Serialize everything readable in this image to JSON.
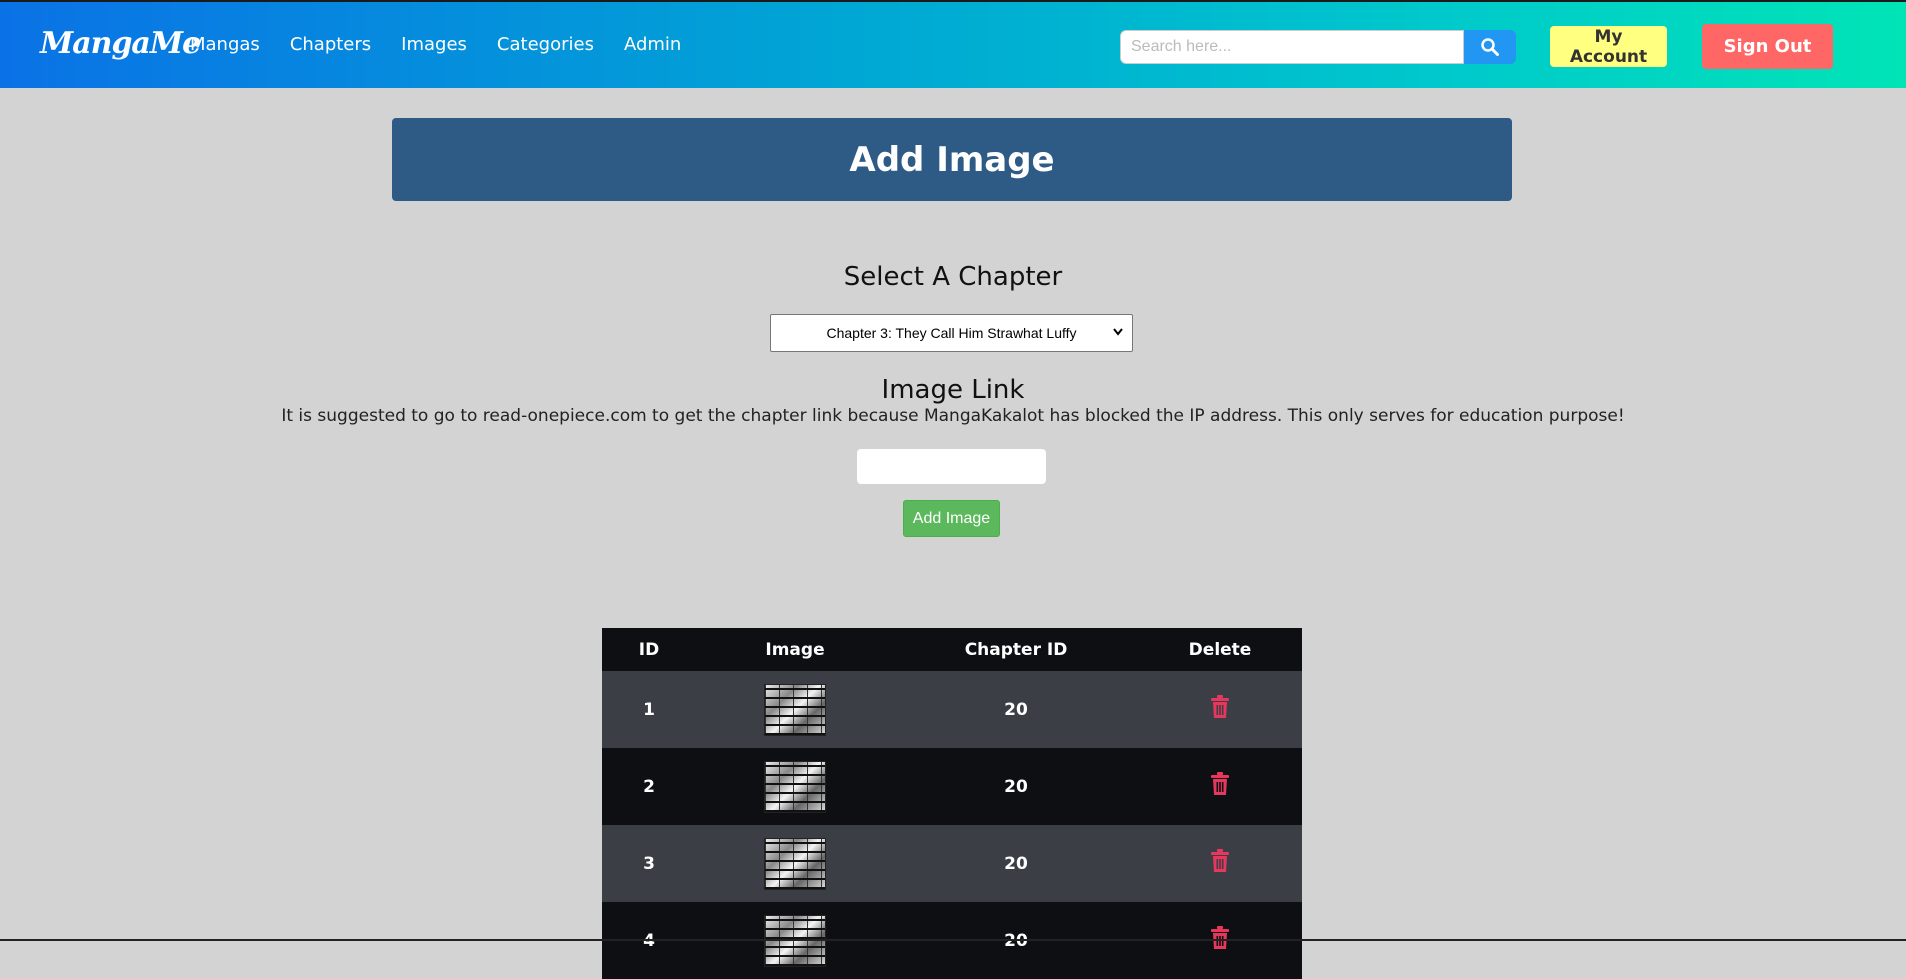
{
  "navbar": {
    "logo": "MangaMe",
    "links": [
      "Mangas",
      "Chapters",
      "Images",
      "Categories",
      "Admin"
    ],
    "search_placeholder": "Search here...",
    "my_account_label": "My Account",
    "sign_out_label": "Sign Out",
    "colors": {
      "gradient_start": "#0a72e6",
      "gradient_end": "#00e4b6",
      "search_button": "#2196f3",
      "account_button": "#ffff80",
      "signout_button": "#ff6666"
    }
  },
  "main": {
    "banner_title": "Add Image",
    "select_heading": "Select A Chapter",
    "selected_chapter": "Chapter 3: They Call Him Strawhat Luffy",
    "link_heading": "Image Link",
    "note": "It is suggested to go to read-onepiece.com to get the chapter link because MangaKakalot has blocked the IP address. This only serves for education purpose!",
    "link_value": "",
    "add_button_label": "Add Image"
  },
  "table": {
    "headers": [
      "ID",
      "Image",
      "Chapter ID",
      "Delete"
    ],
    "rows": [
      {
        "id": "1",
        "image": "manga-page-thumbnail",
        "chapter_id": "20",
        "delete": "trash-icon"
      },
      {
        "id": "2",
        "image": "manga-page-thumbnail",
        "chapter_id": "20",
        "delete": "trash-icon"
      },
      {
        "id": "3",
        "image": "manga-page-thumbnail",
        "chapter_id": "20",
        "delete": "trash-icon"
      },
      {
        "id": "4",
        "image": "manga-page-thumbnail",
        "chapter_id": "20",
        "delete": "trash-icon"
      }
    ]
  }
}
